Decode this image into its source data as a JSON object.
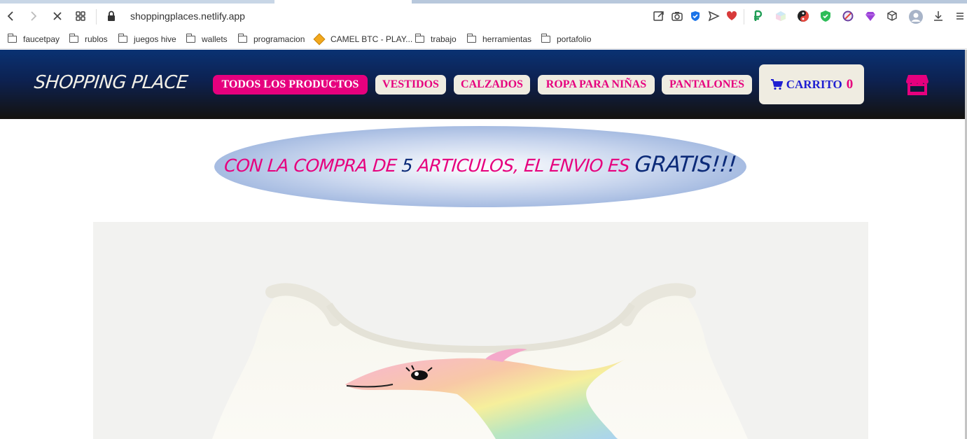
{
  "browser": {
    "url": "shoppingplaces.netlify.app",
    "bookmarks": [
      "faucetpay",
      "rublos",
      "juegos hive",
      "wallets",
      "programacion",
      "CAMEL BTC - PLAY...",
      "trabajo",
      "herramientas",
      "portafolio"
    ]
  },
  "header": {
    "logo": "SHOPPING PLACE",
    "nav": [
      "TODOS LOS PRODUCTOS",
      "VESTIDOS",
      "CALZADOS",
      "ROPA PARA NIÑAS",
      "PANTALONES"
    ],
    "cart_label": "CARRITO",
    "cart_count": "0"
  },
  "promo": {
    "part1": "CON LA COMPRA DE ",
    "number": "5",
    "part2": " ARTICULOS, EL ENVIO ES ",
    "gratis": "GRATIS!!!"
  },
  "colors": {
    "accent_pink": "#e6007e",
    "header_blue": "#0a3273",
    "button_cream": "#efece1",
    "cart_blue": "#1f1fd1"
  }
}
